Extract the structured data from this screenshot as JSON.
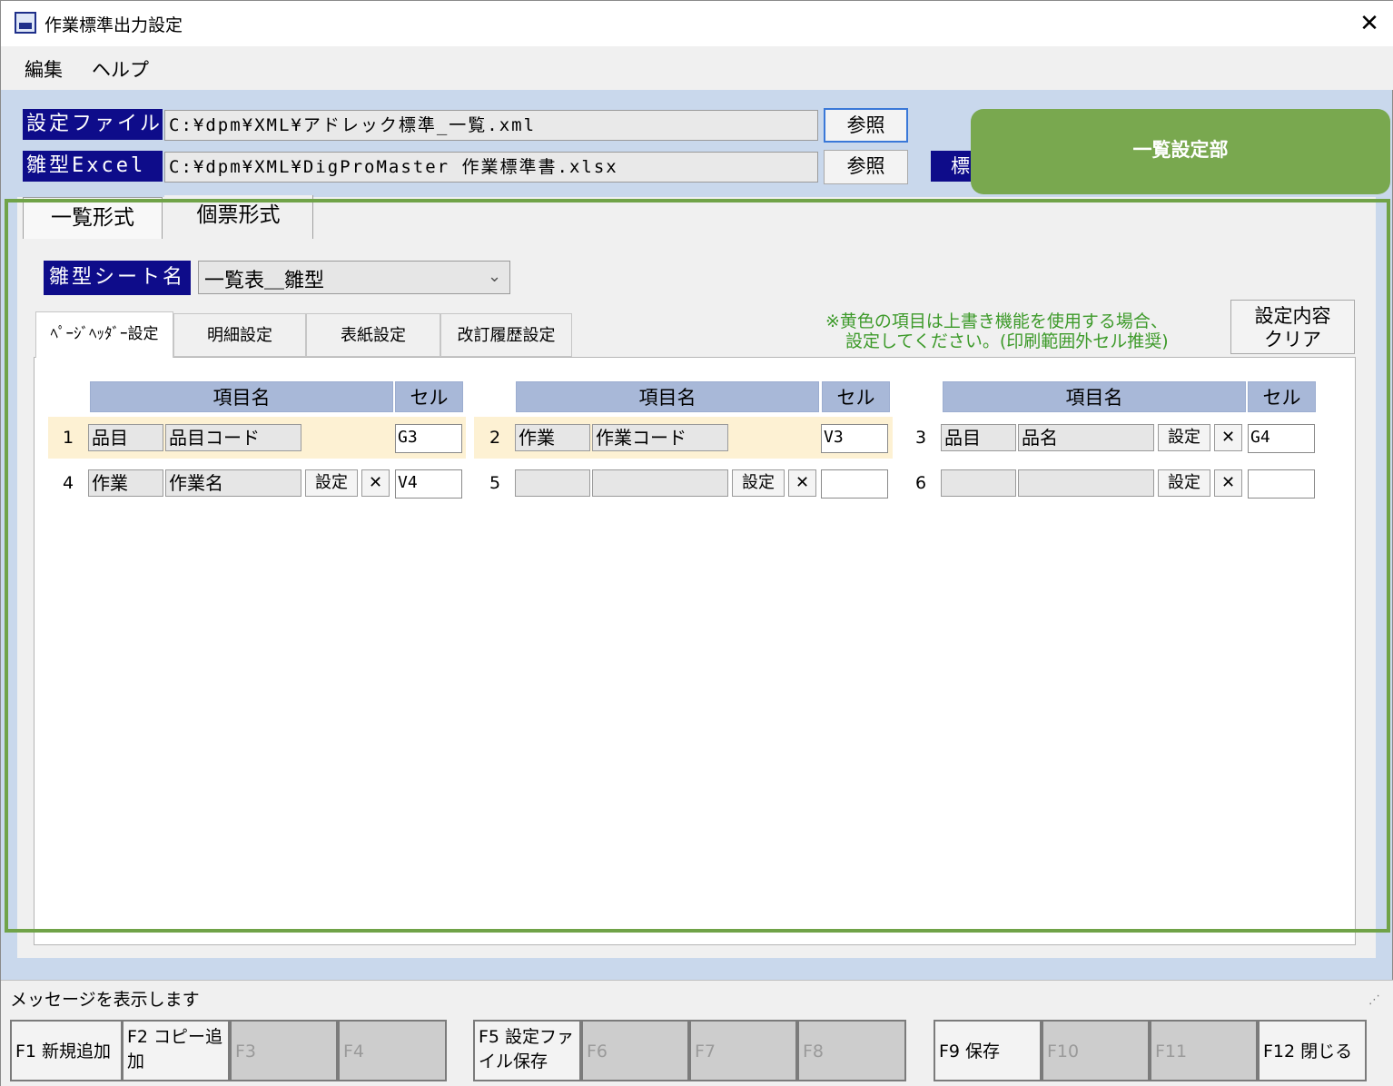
{
  "window": {
    "title": "作業標準出力設定",
    "close": "✕"
  },
  "menu": [
    "編集",
    "ヘルプ"
  ],
  "settings_file": {
    "label": "設定ファイル",
    "path": "C:¥dpm¥XML¥アドレック標準_一覧.xml",
    "browse": "参照"
  },
  "template_excel": {
    "label": "雛型Excel",
    "path": "C:¥dpm¥XML¥DigProMaster 作業標準書.xlsx",
    "browse": "参照"
  },
  "hidden_button_partial": "標",
  "callout": {
    "text": "一覧設定部",
    "color": "#79a84f"
  },
  "tabs": [
    "一覧形式",
    "個票形式"
  ],
  "sheet": {
    "label": "雛型シート名",
    "selected": "一覧表＿雛型"
  },
  "subtabs": [
    "ﾍﾟｰｼﾞﾍｯﾀﾞｰ設定",
    "明細設定",
    "表紙設定",
    "改訂履歴設定"
  ],
  "note": {
    "line1": "※黄色の項目は上書き機能を使用する場合、",
    "line2": "設定してください。(印刷範囲外セル推奨)"
  },
  "clear_button": {
    "line1": "設定内容",
    "line2": "クリア"
  },
  "grid": {
    "headers": {
      "item": "項目名",
      "cell": "セル"
    },
    "set_label": "設定",
    "del_label": "✕",
    "rows": [
      {
        "no": "1",
        "cat": "品目",
        "name": "品目コード",
        "cell": "G3",
        "highlight": true
      },
      {
        "no": "2",
        "cat": "作業",
        "name": "作業コード",
        "cell": "V3",
        "highlight": true
      },
      {
        "no": "3",
        "cat": "品目",
        "name": "品名",
        "cell": "G4",
        "highlight": false
      },
      {
        "no": "4",
        "cat": "作業",
        "name": "作業名",
        "cell": "V4",
        "highlight": false
      },
      {
        "no": "5",
        "cat": "",
        "name": "",
        "cell": "",
        "highlight": false
      },
      {
        "no": "6",
        "cat": "",
        "name": "",
        "cell": "",
        "highlight": false
      }
    ]
  },
  "status": {
    "message": "メッセージを表示します"
  },
  "fkeys": {
    "f1": "F1 新規追加",
    "f2": "F2 コピー追加",
    "f3": "F3",
    "f4": "F4",
    "f5": "F5 設定ファイル保存",
    "f6": "F6",
    "f7": "F7",
    "f8": "F8",
    "f9": "F9 保存",
    "f10": "F10",
    "f11": "F11",
    "f12": "F12 閉じる"
  },
  "colors": {
    "label_bg": "#0e0c8a",
    "highlight_row": "#fdf1d3",
    "header_bg": "#a8b8d8",
    "frame": "#70a348",
    "note": "#3d9a2a"
  }
}
